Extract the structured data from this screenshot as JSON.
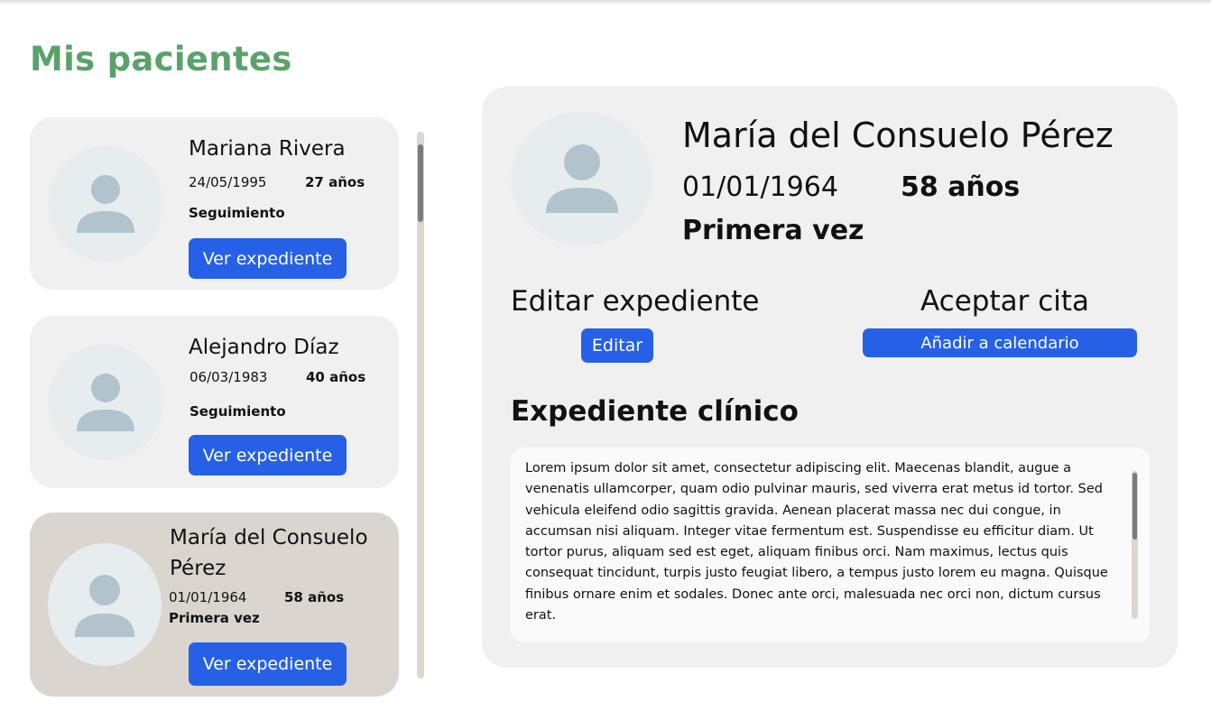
{
  "page": {
    "title": "Mis pacientes"
  },
  "patients": [
    {
      "name": "Mariana Rivera",
      "dob": "24/05/1995",
      "age": "27 años",
      "status": "Seguimiento",
      "button": "Ver expediente"
    },
    {
      "name": "Alejandro Díaz",
      "dob": "06/03/1983",
      "age": "40 años",
      "status": "Seguimiento",
      "button": "Ver expediente"
    },
    {
      "name": "María del Consuelo Pérez",
      "dob": "01/01/1964",
      "age": "58 años",
      "status": "Primera vez",
      "button": "Ver expediente"
    }
  ],
  "detail": {
    "name": "María del Consuelo Pérez",
    "dob": "01/01/1964",
    "age": "58 años",
    "status": "Primera vez",
    "edit_section": {
      "title": "Editar expediente",
      "button": "Editar"
    },
    "appointment_section": {
      "title": "Aceptar cita",
      "button": "Añadir a calendario"
    },
    "record": {
      "title": "Expediente clínico",
      "text": "Lorem ipsum dolor sit amet, consectetur adipiscing elit. Maecenas blandit, augue a venenatis ullamcorper, quam odio pulvinar mauris, sed viverra erat metus id tortor. Sed vehicula eleifend odio sagittis gravida. Aenean placerat massa nec dui congue, in accumsan nisi aliquam. Integer vitae fermentum est. Suspendisse eu efficitur diam. Ut tortor purus, aliquam sed est eget, aliquam finibus orci. Nam maximus, lectus quis consequat tincidunt, turpis justo feugiat libero, a tempus justo lorem eu magna. Quisque finibus ornare enim et sodales. Donec ante orci, malesuada nec orci non, dictum cursus erat."
    }
  },
  "icons": {
    "avatar": "user-avatar-icon"
  },
  "colors": {
    "title_green": "#5aa26a",
    "button_blue": "#2660e7",
    "selected_card": "#dbd5cf",
    "card_bg": "#f0f0f0",
    "avatar_fill": "#b1c3cc"
  }
}
